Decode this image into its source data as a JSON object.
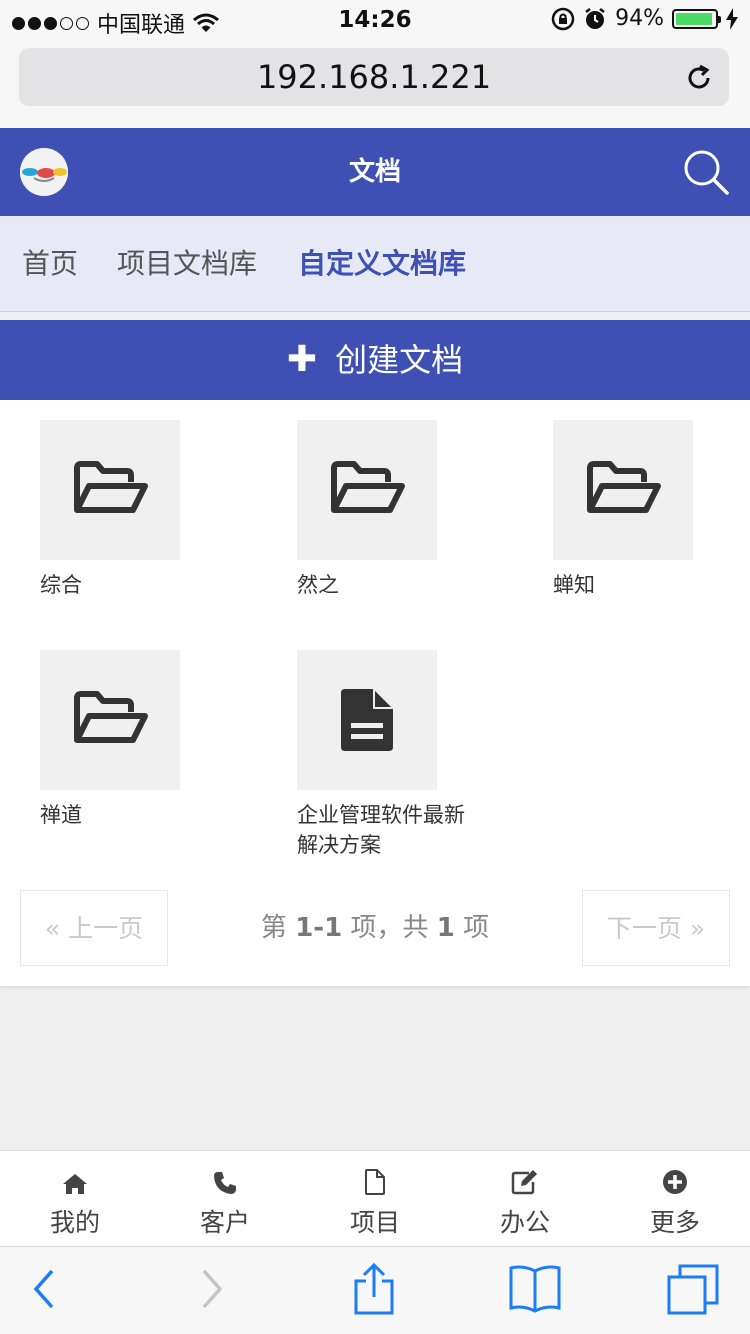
{
  "status": {
    "carrier": "中国联通",
    "time": "14:26",
    "battery_percent": "94%",
    "battery_level": 0.94
  },
  "browser": {
    "url": "192.168.1.221"
  },
  "header": {
    "title": "文档"
  },
  "tabs": [
    {
      "label": "首页"
    },
    {
      "label": "项目文档库"
    },
    {
      "label": "自定义文档库"
    }
  ],
  "create_label": "创建文档",
  "items": [
    {
      "name": "综合",
      "icon": "folder-open-icon"
    },
    {
      "name": "然之",
      "icon": "folder-open-icon"
    },
    {
      "name": "蝉知",
      "icon": "folder-open-icon"
    },
    {
      "name": "禅道",
      "icon": "folder-open-icon"
    },
    {
      "name": "企业管理软件最新解决方案",
      "icon": "document-icon"
    }
  ],
  "pager": {
    "prev": "« 上一页",
    "next": "下一页 »",
    "info_prefix": "第",
    "info_range": "1-1",
    "info_middle": "项，共",
    "info_total": "1",
    "info_suffix": "项"
  },
  "bottom_nav": [
    {
      "label": "我的",
      "icon": "home-icon"
    },
    {
      "label": "客户",
      "icon": "phone-icon"
    },
    {
      "label": "项目",
      "icon": "file-icon"
    },
    {
      "label": "办公",
      "icon": "edit-icon"
    },
    {
      "label": "更多",
      "icon": "plus-circle-icon"
    }
  ],
  "colors": {
    "primary": "#3e50b4",
    "tab_bar_bg": "#e7eaf6",
    "battery": "#4cd964",
    "ios_blue": "#1b7cf6"
  }
}
